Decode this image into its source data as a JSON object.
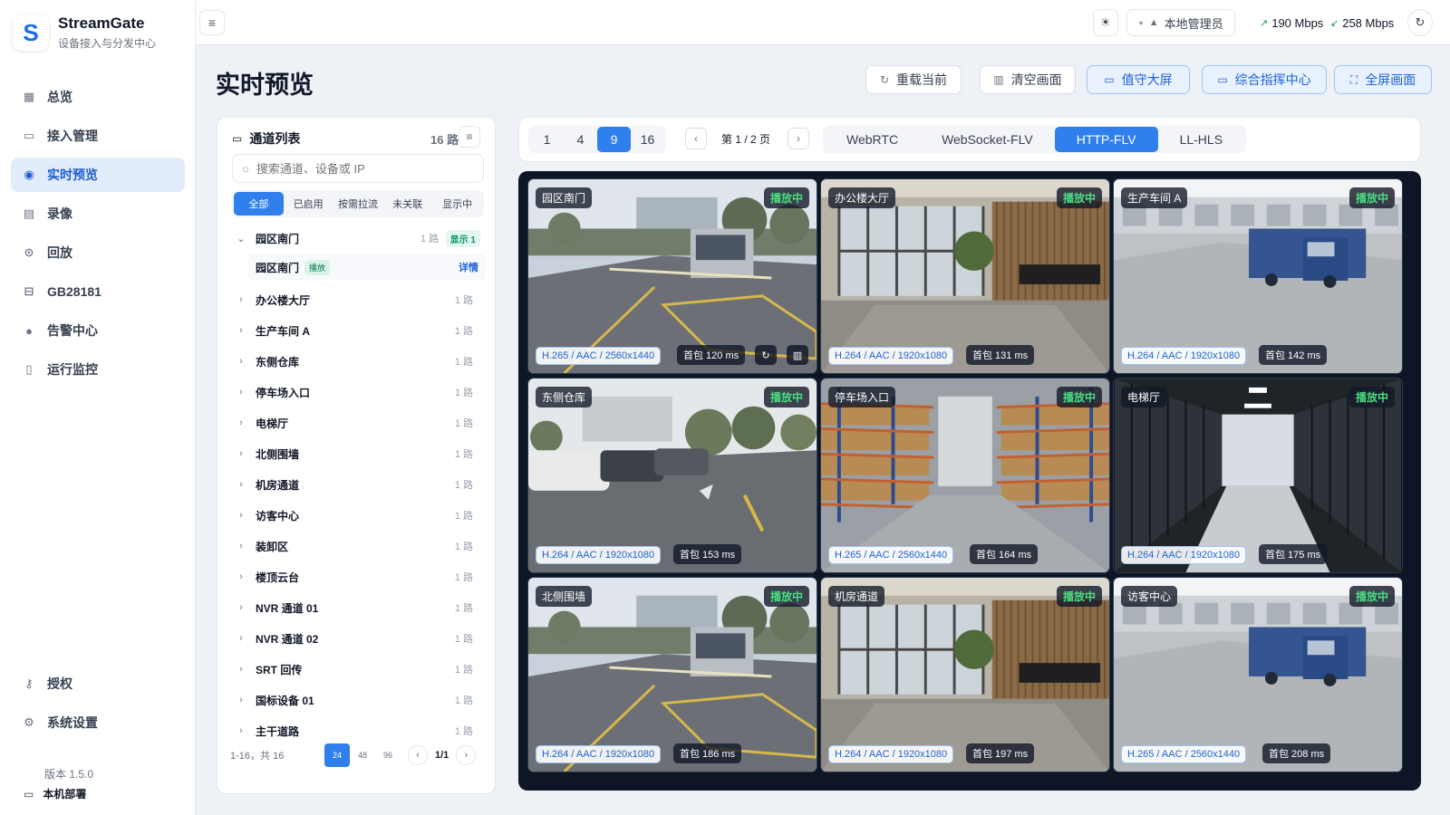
{
  "brand": {
    "name": "StreamGate",
    "subtitle": "设备接入与分发中心",
    "logo_letter": "S"
  },
  "nav": {
    "items": [
      {
        "label": "总览",
        "icon": "grid-icon"
      },
      {
        "label": "接入管理",
        "icon": "monitor-icon"
      },
      {
        "label": "实时预览",
        "icon": "play-circle-icon",
        "active": true
      },
      {
        "label": "录像",
        "icon": "archive-icon"
      },
      {
        "label": "回放",
        "icon": "replay-icon"
      },
      {
        "label": "GB28181",
        "icon": "device-icon"
      },
      {
        "label": "告警中心",
        "icon": "alert-icon"
      },
      {
        "label": "运行监控",
        "icon": "document-icon"
      }
    ],
    "bottom": [
      {
        "label": "授权",
        "icon": "key-icon"
      },
      {
        "label": "系统设置",
        "icon": "gear-icon"
      }
    ],
    "version": "版本 1.5.0",
    "deploy": "本机部署"
  },
  "topbar": {
    "user": "本地管理员",
    "upload_rate": "190 Mbps",
    "download_rate": "258 Mbps"
  },
  "page": {
    "title": "实时预览",
    "actions": [
      "重载当前",
      "清空画面",
      "值守大屏",
      "综合指挥中心",
      "全屏画面"
    ]
  },
  "channels": {
    "title": "通道列表",
    "count": "16 路",
    "search_placeholder": "搜索通道、设备或 IP",
    "filters": [
      "全部",
      "已启用",
      "按需拉流",
      "未关联",
      "显示中"
    ],
    "expanded": {
      "name": "园区南门",
      "count": "1 路",
      "shown": "显示 1",
      "child": {
        "name": "园区南门",
        "tag": "播放",
        "action": "详情"
      }
    },
    "groups": [
      {
        "name": "办公楼大厅",
        "count": "1 路"
      },
      {
        "name": "生产车间 A",
        "count": "1 路"
      },
      {
        "name": "东侧仓库",
        "count": "1 路"
      },
      {
        "name": "停车场入口",
        "count": "1 路"
      },
      {
        "name": "电梯厅",
        "count": "1 路"
      },
      {
        "name": "北侧围墙",
        "count": "1 路"
      },
      {
        "name": "机房通道",
        "count": "1 路"
      },
      {
        "name": "访客中心",
        "count": "1 路"
      },
      {
        "name": "装卸区",
        "count": "1 路"
      },
      {
        "name": "楼顶云台",
        "count": "1 路"
      },
      {
        "name": "NVR 通道 01",
        "count": "1 路"
      },
      {
        "name": "NVR 通道 02",
        "count": "1 路"
      },
      {
        "name": "SRT 回传",
        "count": "1 路"
      },
      {
        "name": "国标设备 01",
        "count": "1 路"
      },
      {
        "name": "主干道路",
        "count": "1 路"
      }
    ],
    "pager": {
      "range": "1-16，共 16",
      "sizes": [
        "24",
        "48",
        "96"
      ],
      "page": "1/1"
    }
  },
  "video": {
    "grid_options": [
      "1",
      "4",
      "9",
      "16"
    ],
    "grid_selected": "9",
    "page_text": "第 1 / 2 页",
    "protocols": [
      "WebRTC",
      "WebSocket-FLV",
      "HTTP-FLV",
      "LL-HLS"
    ],
    "protocol_selected": "HTTP-FLV",
    "status_label": "播放中",
    "tiles": [
      {
        "name": "园区南门",
        "codec": "H.265 / AAC / 2560x1440",
        "latency": "首包 120 ms",
        "scene": "gate"
      },
      {
        "name": "办公楼大厅",
        "codec": "H.264 / AAC / 1920x1080",
        "latency": "首包 131 ms",
        "scene": "lobby"
      },
      {
        "name": "生产车间 A",
        "codec": "H.264 / AAC / 1920x1080",
        "latency": "首包 142 ms",
        "scene": "truck"
      },
      {
        "name": "东侧仓库",
        "codec": "H.264 / AAC / 1920x1080",
        "latency": "首包 153 ms",
        "scene": "parking"
      },
      {
        "name": "停车场入口",
        "codec": "H.265 / AAC / 2560x1440",
        "latency": "首包 164 ms",
        "scene": "warehouse"
      },
      {
        "name": "电梯厅",
        "codec": "H.264 / AAC / 1920x1080",
        "latency": "首包 175 ms",
        "scene": "serverroom"
      },
      {
        "name": "北侧围墙",
        "codec": "H.264 / AAC / 1920x1080",
        "latency": "首包 186 ms",
        "scene": "gate"
      },
      {
        "name": "机房通道",
        "codec": "H.264 / AAC / 1920x1080",
        "latency": "首包 197 ms",
        "scene": "lobby"
      },
      {
        "name": "访客中心",
        "codec": "H.265 / AAC / 2560x1440",
        "latency": "首包 208 ms",
        "scene": "truck"
      }
    ]
  },
  "colors": {
    "accent": "#2f80ed",
    "stage": "#0e1626",
    "playing": "#4ade80"
  }
}
